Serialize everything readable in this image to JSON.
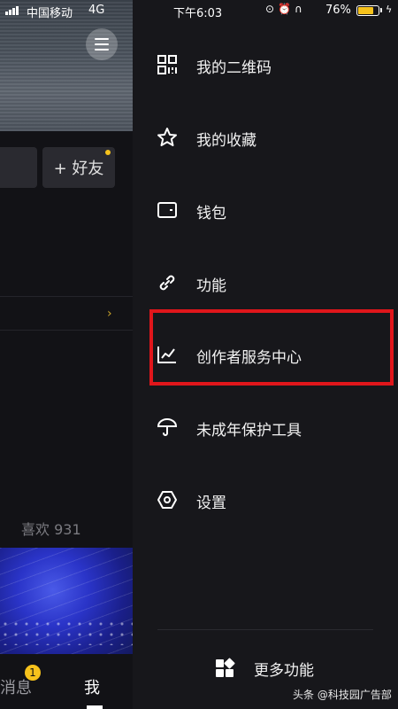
{
  "status_bar": {
    "carrier": "中国移动",
    "network": "4G",
    "time": "下午6:03",
    "battery_pct": "76%",
    "battery_level": 0.76,
    "battery_color": "#f6c21c"
  },
  "background_profile": {
    "add_friend_label": "+ 好友",
    "likes_label": "喜欢 931",
    "tabs": {
      "messages_label": "消息",
      "messages_badge": "1",
      "me_label": "我"
    }
  },
  "drawer": {
    "items": [
      {
        "label": "我的二维码",
        "icon": "qr-code-icon"
      },
      {
        "label": "我的收藏",
        "icon": "star-icon"
      },
      {
        "label": "钱包",
        "icon": "wallet-icon"
      },
      {
        "label": "功能",
        "icon": "link-icon"
      },
      {
        "label": "创作者服务中心",
        "icon": "chart-icon",
        "highlighted": true
      },
      {
        "label": "未成年保护工具",
        "icon": "umbrella-icon"
      },
      {
        "label": "设置",
        "icon": "settings-hexagon-icon"
      }
    ],
    "more_label": "更多功能",
    "highlight_color": "#e0161b"
  },
  "watermark": "头条 @科技园广告部"
}
